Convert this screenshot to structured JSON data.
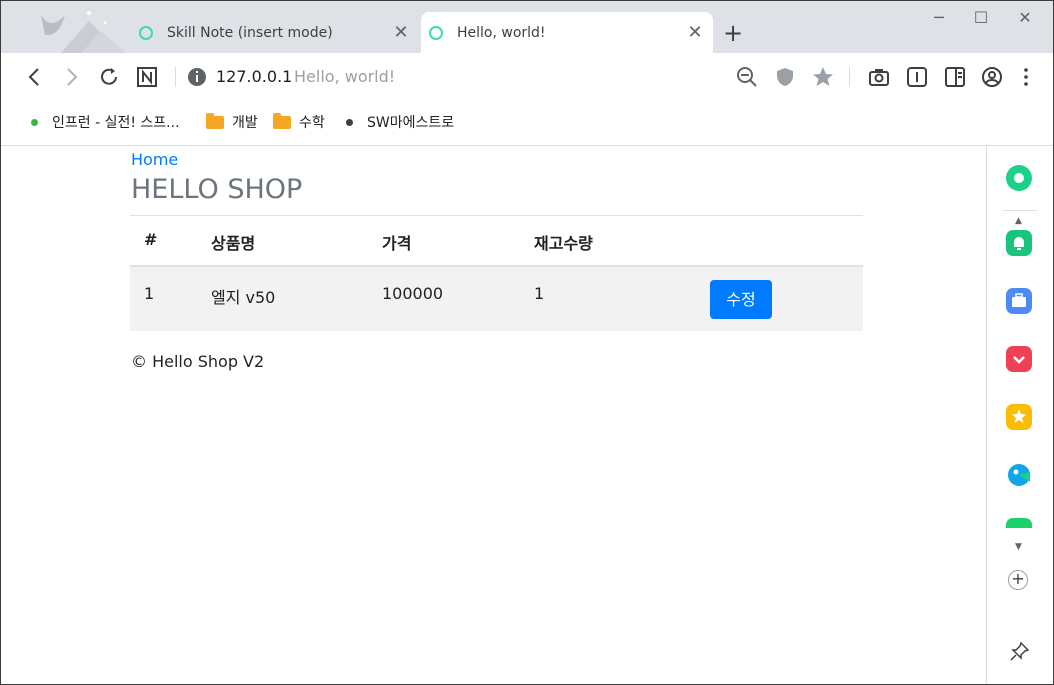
{
  "browser": {
    "tabs": [
      {
        "title": "Skill Note (insert mode)",
        "active": false
      },
      {
        "title": "Hello, world!",
        "active": true
      }
    ],
    "new_tab": "+",
    "window": {
      "minimize": "─",
      "maximize": "☐",
      "close": "✕"
    },
    "address": {
      "host": "127.0.0.1",
      "page_title": "Hello, world!"
    },
    "bookmarks": [
      {
        "label": "인프런 - 실전! 스프...",
        "icon": "green-dot"
      },
      {
        "label": "개발",
        "icon": "folder"
      },
      {
        "label": "수학",
        "icon": "folder"
      },
      {
        "label": "SW마에스트로",
        "icon": "dark-dot"
      }
    ]
  },
  "page": {
    "breadcrumb": "Home",
    "title": "HELLO SHOP",
    "table": {
      "headers": [
        "#",
        "상품명",
        "가격",
        "재고수량",
        ""
      ],
      "rows": [
        {
          "id": "1",
          "name": "엘지 v50",
          "price": "100000",
          "stock": "1",
          "action": "수정"
        }
      ]
    },
    "footer": "© Hello Shop V2"
  },
  "colors": {
    "accent": "#007bff",
    "tab_favicon": "#3dd9b6"
  }
}
